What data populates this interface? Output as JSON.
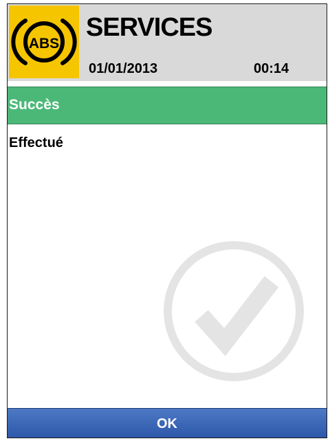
{
  "header": {
    "title": "SERVICES",
    "date": "01/01/2013",
    "time": "00:14",
    "logo_icon": "abs-warning-icon",
    "logo_text": "ABS"
  },
  "status": {
    "label": "Succès",
    "color": "#4cb878"
  },
  "content": {
    "message": "Effectué",
    "watermark_icon": "checkmark-circle-icon"
  },
  "actions": {
    "ok_label": "OK",
    "color": "#2f5fb3"
  }
}
